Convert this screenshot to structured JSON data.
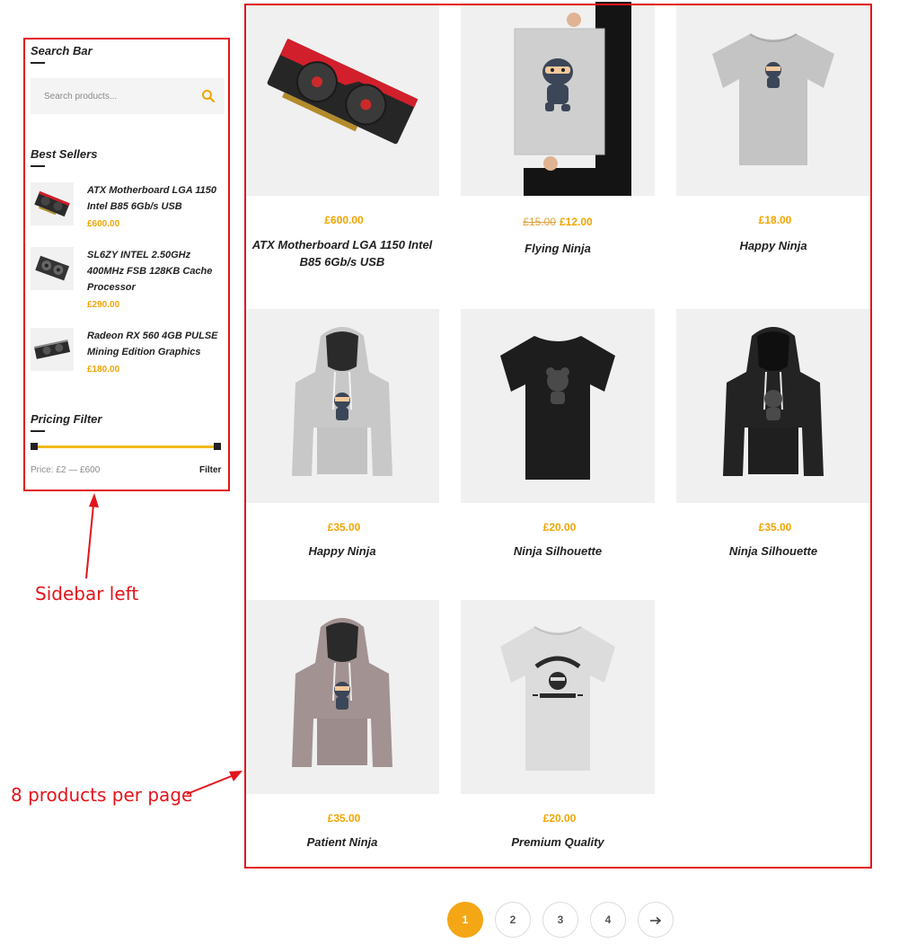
{
  "sidebar": {
    "search": {
      "title": "Search Bar",
      "placeholder": "Search products..."
    },
    "best_sellers": {
      "title": "Best Sellers",
      "items": [
        {
          "name": "ATX Motherboard LGA 1150 Intel B85 6Gb/s USB",
          "price": "£600.00"
        },
        {
          "name": "SL6ZY INTEL 2.50GHz 400MHz FSB 128KB Cache Processor",
          "price": "£290.00"
        },
        {
          "name": "Radeon RX 560 4GB PULSE Mining Edition Graphics",
          "price": "£180.00"
        }
      ]
    },
    "pricing_filter": {
      "title": "Pricing Filter",
      "price_range": "Price: £2 — £600",
      "filter_label": "Filter"
    }
  },
  "products": [
    {
      "title": "ATX Motherboard LGA 1150 Intel B85 6Gb/s USB",
      "price": "£600.00",
      "old_price": ""
    },
    {
      "title": "Flying Ninja",
      "price": "£12.00",
      "old_price": "£15.00"
    },
    {
      "title": "Happy Ninja",
      "price": "£18.00",
      "old_price": ""
    },
    {
      "title": "Happy Ninja",
      "price": "£35.00",
      "old_price": ""
    },
    {
      "title": "Ninja Silhouette",
      "price": "£20.00",
      "old_price": ""
    },
    {
      "title": "Ninja Silhouette",
      "price": "£35.00",
      "old_price": ""
    },
    {
      "title": "Patient Ninja",
      "price": "£35.00",
      "old_price": ""
    },
    {
      "title": "Premium Quality",
      "price": "£20.00",
      "old_price": ""
    }
  ],
  "pagination": {
    "pages": [
      "1",
      "2",
      "3",
      "4"
    ],
    "current": "1",
    "next_icon": "arrow-right-icon"
  },
  "annotations": {
    "sidebar_label": "Sidebar left",
    "products_label": "8 products per page"
  },
  "colors": {
    "accent": "#f4a615",
    "price": "#f0a500",
    "annotation": "#e3141b"
  }
}
